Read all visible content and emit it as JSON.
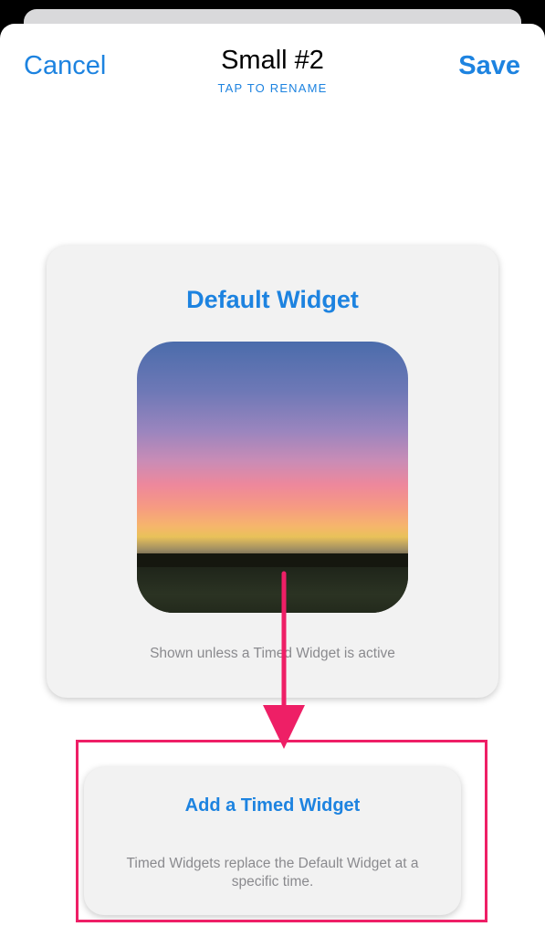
{
  "nav": {
    "cancel_label": "Cancel",
    "title": "Small #2",
    "rename_hint": "TAP TO RENAME",
    "save_label": "Save"
  },
  "default_widget": {
    "title": "Default Widget",
    "caption": "Shown unless a Timed Widget is active"
  },
  "timed_widget": {
    "title": "Add a Timed Widget",
    "description": "Timed Widgets replace the Default Widget at a specific time."
  },
  "colors": {
    "accent": "#1d83e0",
    "annotation": "#ee1f66",
    "card_background": "#f2f2f2",
    "secondary_text": "#8a8a8e"
  }
}
